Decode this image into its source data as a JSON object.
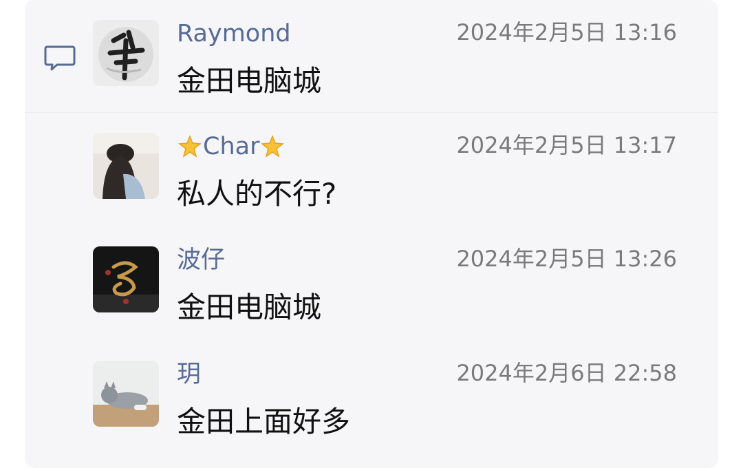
{
  "comments": [
    {
      "name": "Raymond",
      "time": "2024年2月5日 13:16",
      "text": "金田电脑城",
      "avatar": "calligraphy-avatar"
    },
    {
      "name": "Char",
      "time": "2024年2月5日 13:17",
      "text": "私人的不行?",
      "avatar": "girl-photo-avatar"
    },
    {
      "name": "波仔",
      "time": "2024年2月5日 13:26",
      "text": "金田电脑城",
      "avatar": "dark-logo-avatar"
    },
    {
      "name": "玥",
      "time": "2024年2月6日 22:58",
      "text": "金田上面好多",
      "avatar": "cat-photo-avatar"
    }
  ],
  "colors": {
    "name": "#576b95",
    "time": "#7a7a7a",
    "text": "#111111",
    "panel": "#f6f6f8"
  },
  "icons": {
    "comment_section": "comment-bubble-icon",
    "name_decoration": "star-emoji-icon"
  }
}
